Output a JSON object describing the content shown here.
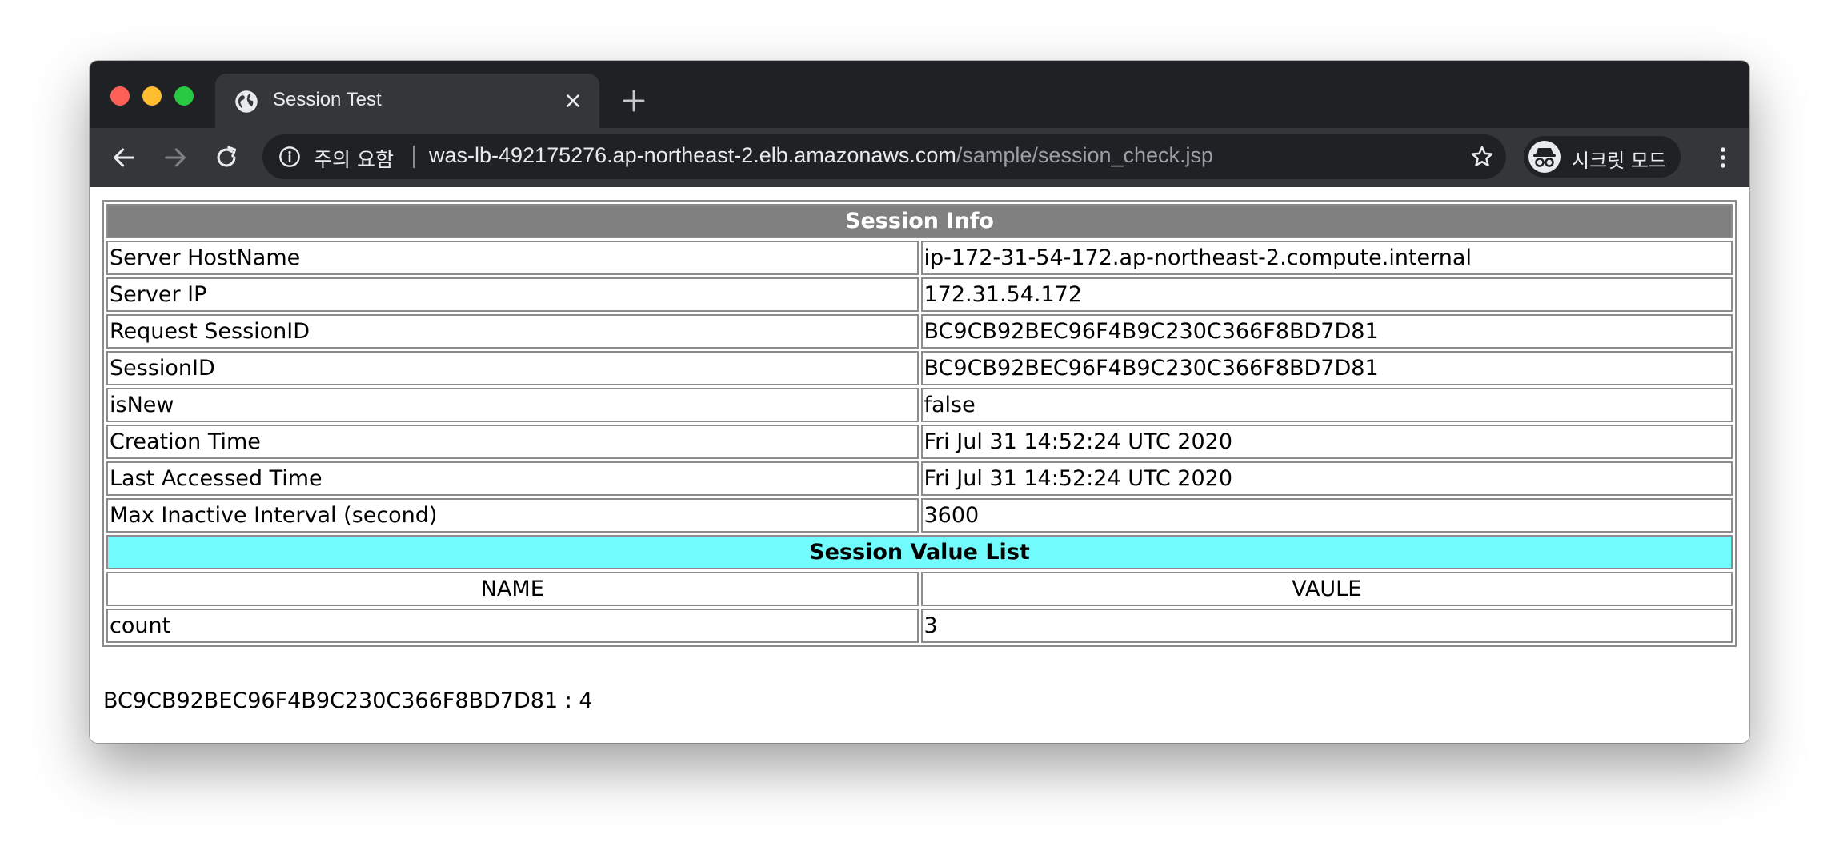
{
  "browser": {
    "tab": {
      "title": "Session Test",
      "icon": "globe-icon"
    },
    "omnibox": {
      "security_label": "주의 요함",
      "url_host": "was-lb-492175276.ap-northeast-2.elb.amazonaws.com",
      "url_path": "/sample/session_check.jsp"
    },
    "incognito_label": "시크릿 모드"
  },
  "page": {
    "session_info_header": "Session Info",
    "rows": [
      {
        "key": "Server HostName",
        "value": "ip-172-31-54-172.ap-northeast-2.compute.internal"
      },
      {
        "key": "Server IP",
        "value": "172.31.54.172"
      },
      {
        "key": "Request SessionID",
        "value": "BC9CB92BEC96F4B9C230C366F8BD7D81"
      },
      {
        "key": "SessionID",
        "value": "BC9CB92BEC96F4B9C230C366F8BD7D81"
      },
      {
        "key": "isNew",
        "value": "false"
      },
      {
        "key": "Creation Time",
        "value": "Fri Jul 31 14:52:24 UTC 2020"
      },
      {
        "key": "Last Accessed Time",
        "value": "Fri Jul 31 14:52:24 UTC 2020"
      },
      {
        "key": "Max Inactive Interval (second)",
        "value": "3600"
      }
    ],
    "value_list_header": "Session Value List",
    "columns": {
      "name": "NAME",
      "value": "VAULE"
    },
    "values": [
      {
        "name": "count",
        "value": "3"
      }
    ],
    "footer_text": "BC9CB92BEC96F4B9C230C366F8BD7D81 : 4"
  },
  "colors": {
    "header_gray": "#808080",
    "header_cyan": "#72fbfc",
    "chrome_dark": "#202124",
    "chrome_toolbar": "#35363a"
  }
}
